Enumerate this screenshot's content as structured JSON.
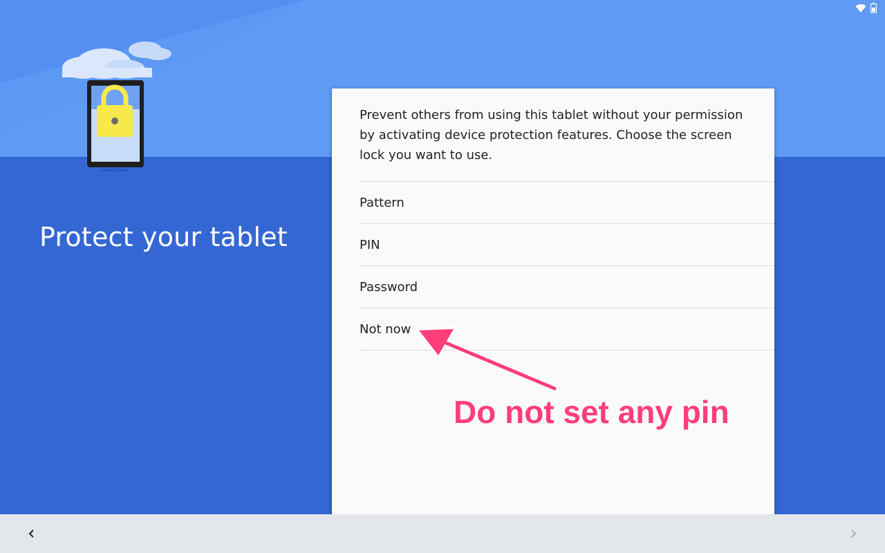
{
  "colors": {
    "top_background": "#5f9af5",
    "bottom_background": "#3567d4",
    "nav_background": "#e3e6ea",
    "card_background": "#fafafa",
    "annotation": "#ff3d7a",
    "lock": "#f7e94a"
  },
  "status_bar": {
    "icons": [
      "wifi-icon",
      "battery-icon"
    ]
  },
  "illustration": {
    "icons": [
      "cloud-icon",
      "tablet-icon",
      "padlock-icon"
    ]
  },
  "page": {
    "title": "Protect your tablet"
  },
  "card": {
    "description": "Prevent others from using this tablet without your permission by activating device protection features. Choose the screen lock you want to use.",
    "options": [
      {
        "label": "Pattern"
      },
      {
        "label": "PIN"
      },
      {
        "label": "Password"
      },
      {
        "label": "Not now"
      }
    ]
  },
  "annotation": {
    "text": "Do not set any pin"
  },
  "nav": {
    "back_icon": "chevron-left-icon",
    "next_icon": "chevron-right-icon"
  }
}
